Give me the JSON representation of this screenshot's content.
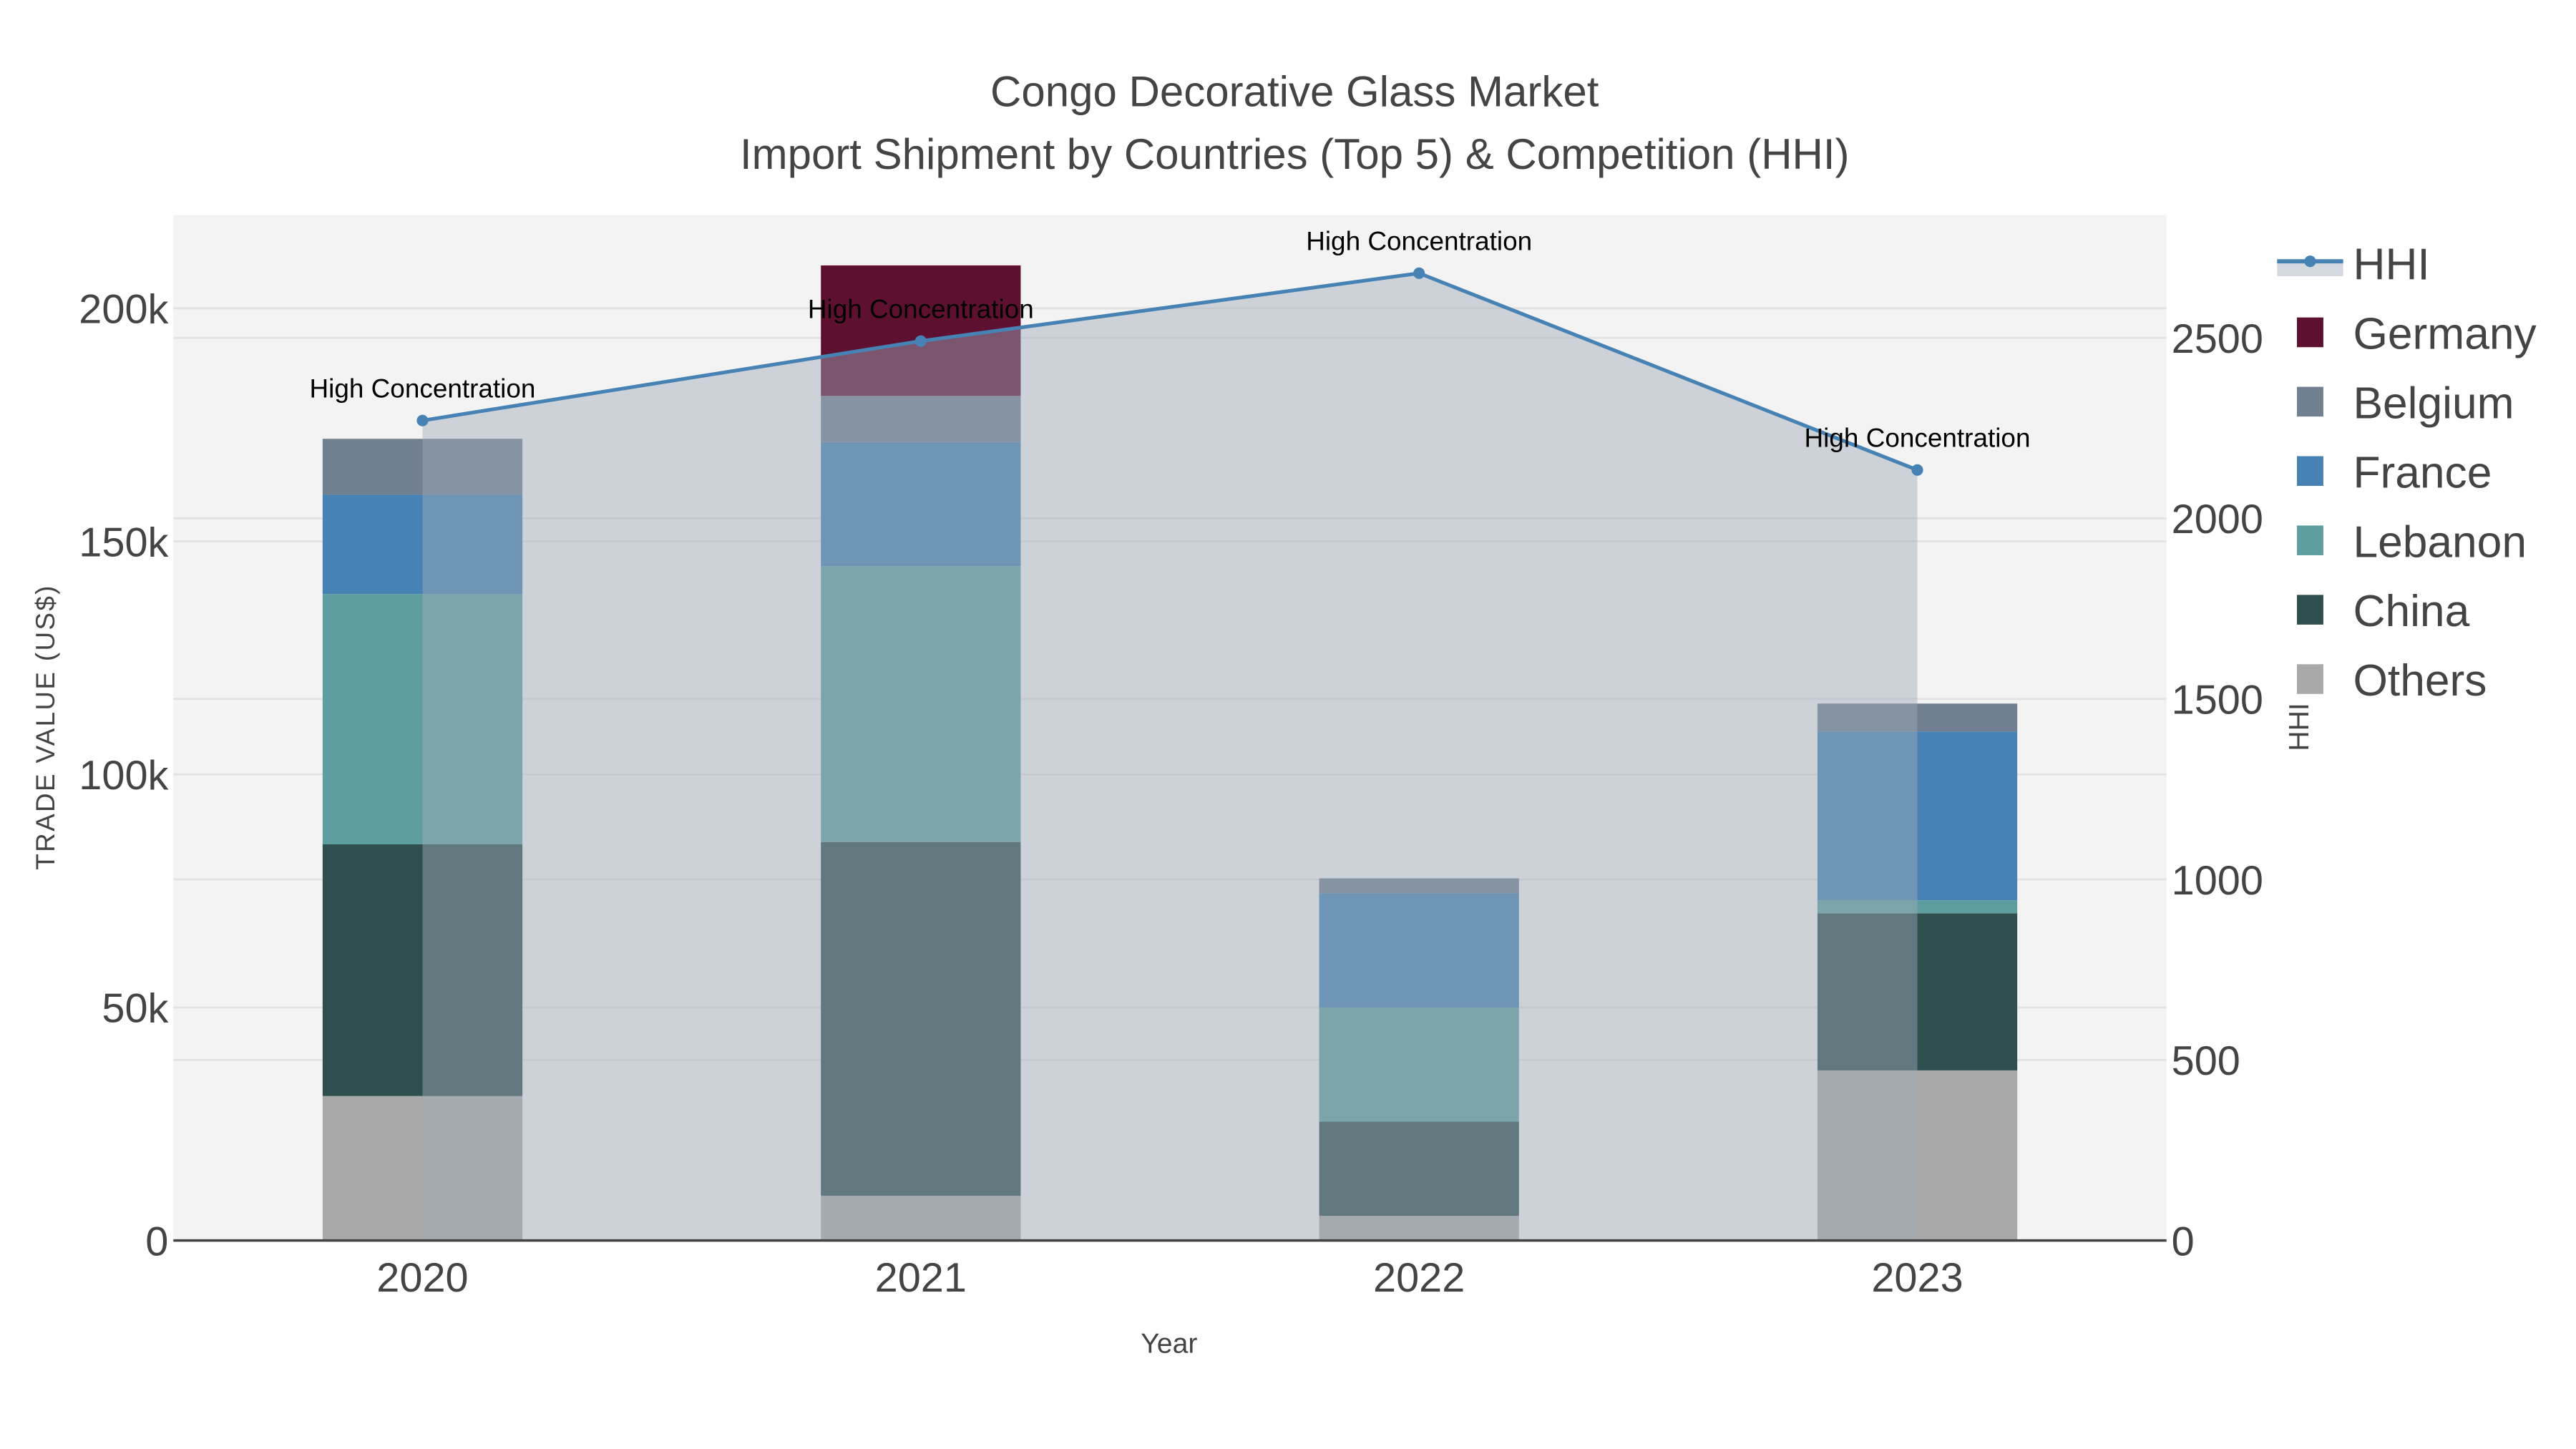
{
  "chart_data": {
    "type": "bar",
    "title": "Congo Decorative Glass Market",
    "subtitle": "Import Shipment by Countries (Top 5) & Competition (HHI)",
    "xlabel": "Year",
    "ylabel": "TRADE VALUE (US$)",
    "y2label": "HHI",
    "categories": [
      "2020",
      "2021",
      "2022",
      "2023"
    ],
    "ylim": [
      0,
      220000
    ],
    "y2lim": [
      0,
      2840
    ],
    "yticks": [
      0,
      50000,
      100000,
      150000,
      200000
    ],
    "ytick_labels": [
      "0",
      "50k",
      "100k",
      "150k",
      "200k"
    ],
    "y2ticks": [
      0,
      500,
      1000,
      1500,
      2000,
      2500
    ],
    "y2tick_labels": [
      "0",
      "500",
      "1000",
      "1500",
      "2000",
      "2500"
    ],
    "grid": true,
    "legend_position": "right",
    "stacked": true,
    "series": [
      {
        "name": "Others",
        "color": "#a9a9a9",
        "values": [
          31000,
          9600,
          5300,
          36500
        ]
      },
      {
        "name": "China",
        "color": "#2f4f4f",
        "values": [
          54000,
          75900,
          20200,
          33700
        ]
      },
      {
        "name": "Lebanon",
        "color": "#5f9ea0",
        "values": [
          53700,
          59200,
          24500,
          2800
        ]
      },
      {
        "name": "France",
        "color": "#4682b4",
        "values": [
          21300,
          26600,
          24500,
          36200
        ]
      },
      {
        "name": "Belgium",
        "color": "#708090",
        "values": [
          12000,
          9900,
          3200,
          6000
        ]
      },
      {
        "name": "Germany",
        "color": "#5e1030",
        "values": [
          0,
          28000,
          0,
          0
        ]
      }
    ],
    "legend_order": [
      "HHI",
      "Germany",
      "Belgium",
      "France",
      "Lebanon",
      "China",
      "Others"
    ],
    "hhi": {
      "name": "HHI",
      "color": "#4682b4",
      "values": [
        2271,
        2491,
        2679,
        2134
      ],
      "annotations": [
        "High Concentration",
        "High Concentration",
        "High Concentration",
        "High Concentration"
      ]
    }
  }
}
